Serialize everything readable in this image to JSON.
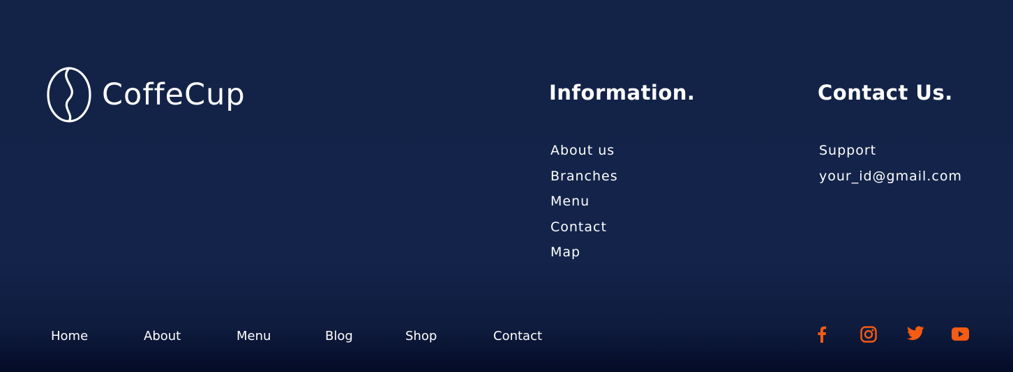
{
  "brand": {
    "name": "CoffeCup",
    "logo_icon": "coffee-bean-icon"
  },
  "information": {
    "heading": "Information.",
    "links": [
      "About us",
      "Branches",
      "Menu",
      "Contact",
      "Map"
    ]
  },
  "contact": {
    "heading": "Contact Us.",
    "items": [
      "Support",
      "your_id@gmail.com"
    ]
  },
  "bottom_nav": [
    "Home",
    "About",
    "Menu",
    "Blog",
    "Shop",
    "Contact"
  ],
  "social": {
    "accent_color": "#f55b12",
    "icons": [
      "facebook-icon",
      "instagram-icon",
      "twitter-icon",
      "youtube-icon"
    ]
  },
  "colors": {
    "background": "#132347",
    "text": "#ffffff"
  }
}
